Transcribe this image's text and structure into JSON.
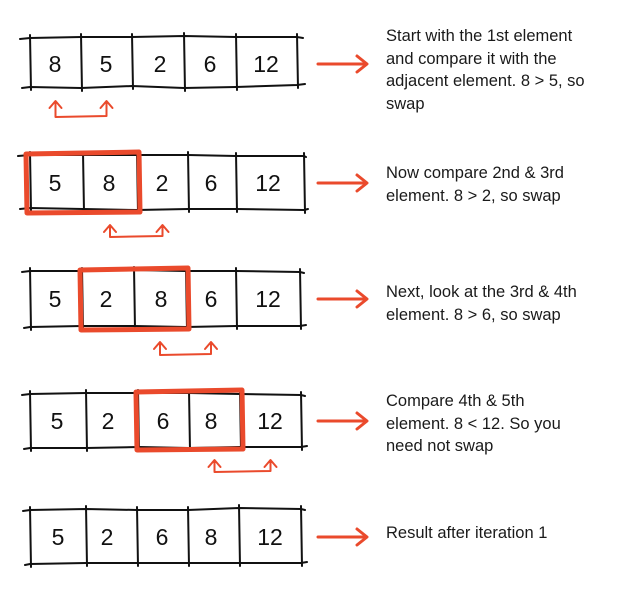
{
  "colors": {
    "ink": "#111111",
    "accent": "#ea4a2c"
  },
  "steps": [
    {
      "values": [
        "8",
        "5",
        "2",
        "6",
        "12"
      ],
      "highlight": null,
      "swap_indicator": [
        0,
        1
      ],
      "lines": [
        "Start with the 1st element",
        "and compare it with the",
        "adjacent element. 8 > 5, so",
        "swap"
      ]
    },
    {
      "values": [
        "5",
        "8",
        "2",
        "6",
        "12"
      ],
      "highlight": [
        0,
        1
      ],
      "swap_indicator": [
        1,
        2
      ],
      "lines": [
        "Now compare 2nd & 3rd",
        "element. 8 > 2, so swap"
      ]
    },
    {
      "values": [
        "5",
        "2",
        "8",
        "6",
        "12"
      ],
      "highlight": [
        1,
        2
      ],
      "swap_indicator": [
        2,
        3
      ],
      "lines": [
        "Next, look at the 3rd & 4th",
        "element. 8 > 6, so swap"
      ]
    },
    {
      "values": [
        "5",
        "2",
        "6",
        "8",
        "12"
      ],
      "highlight": [
        2,
        3
      ],
      "swap_indicator": [
        3,
        4
      ],
      "lines": [
        "Compare 4th & 5th",
        "element. 8 < 12. So you",
        "need not swap"
      ]
    },
    {
      "values": [
        "5",
        "2",
        "6",
        "8",
        "12"
      ],
      "highlight": null,
      "swap_indicator": null,
      "lines": [
        "Result after iteration 1"
      ]
    }
  ]
}
